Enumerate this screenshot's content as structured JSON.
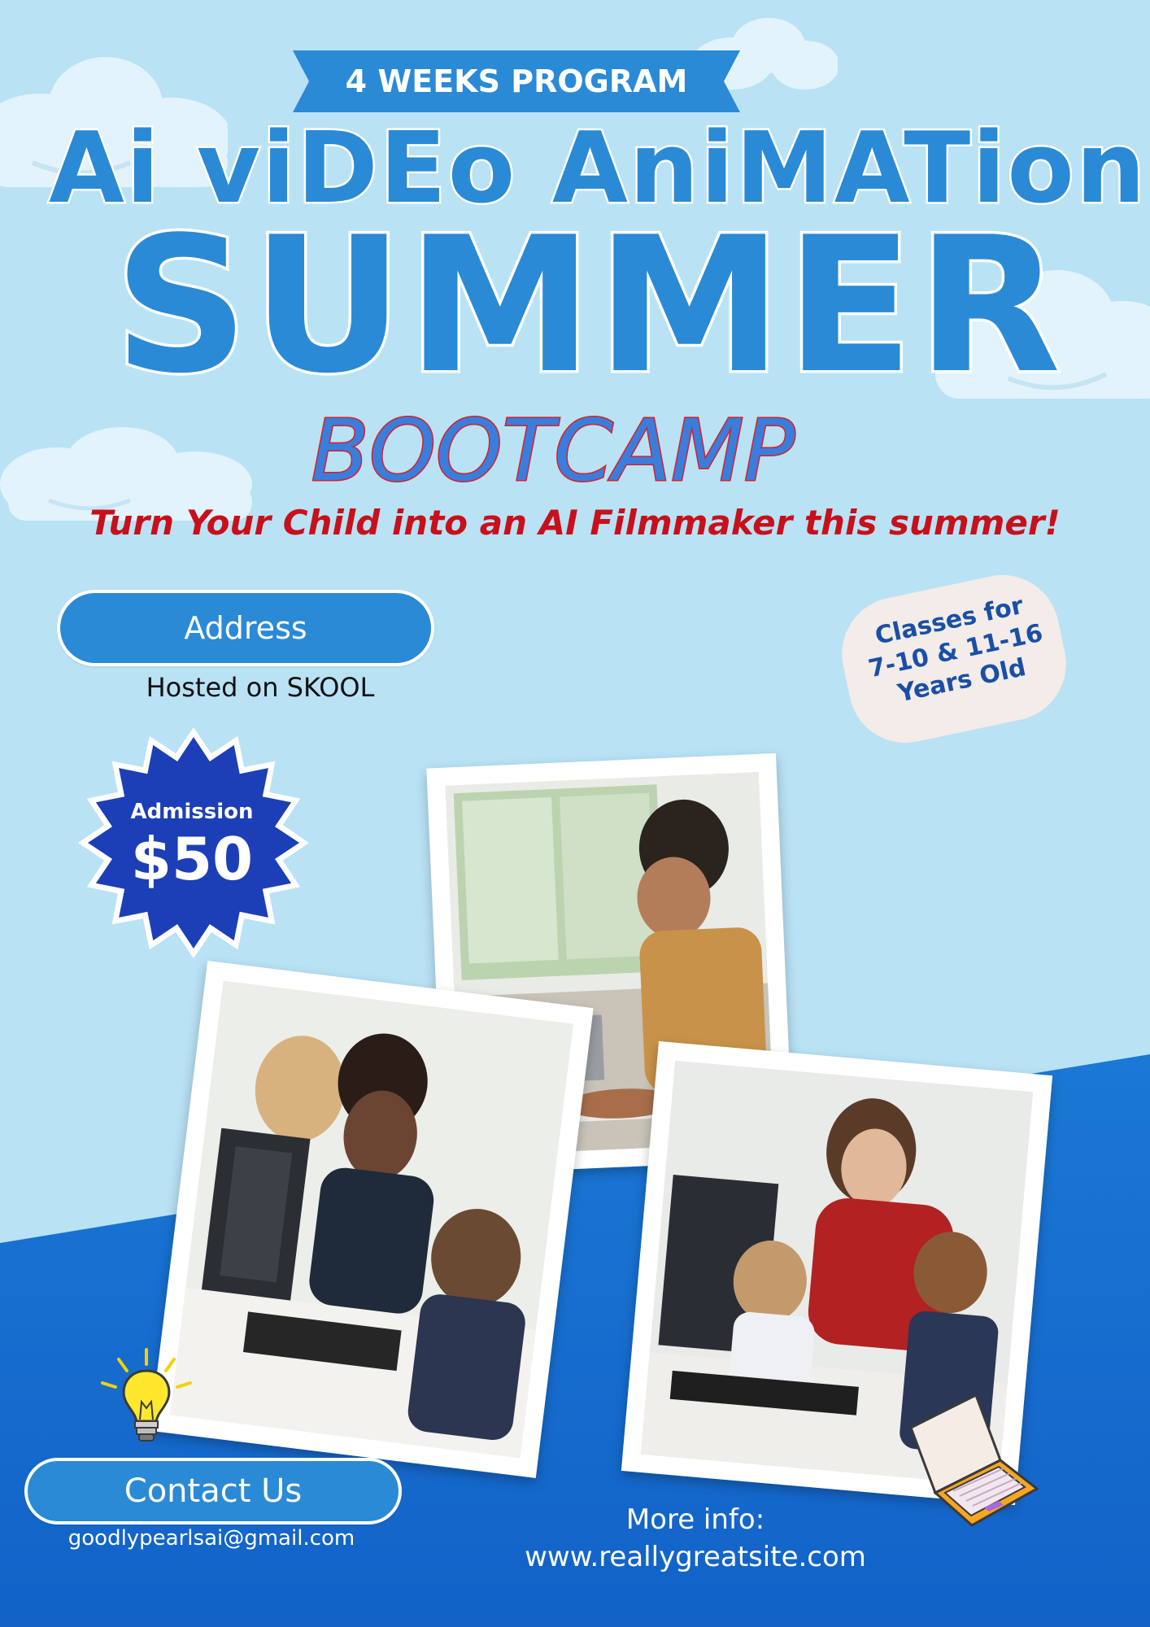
{
  "poster": {
    "ribbon_text": "4 WEEKS PROGRAM",
    "title_line1": "Ai viDEo AniMATion",
    "title_line2": "SUMMER",
    "title_line3": "BOOTCAMP",
    "tagline": "Turn Your Child into an AI Filmmaker this summer!"
  },
  "address": {
    "label": "Address",
    "value": "Hosted on SKOOL"
  },
  "classes_badge": {
    "line1": "Classes for",
    "line2": "7-10 & 11-16",
    "line3": "Years Old"
  },
  "admission": {
    "label": "Admission",
    "price": "$50"
  },
  "contact": {
    "label": "Contact Us",
    "email": "goodlypearlsai@gmail.com"
  },
  "more_info": {
    "label": "More info:",
    "url": "www.reallygreatsite.com"
  },
  "colors": {
    "sky": "#b9e2f5",
    "accent_blue": "#2a8ad6",
    "deep_blue": "#1565c8",
    "tagline_red": "#c8101b",
    "badge_navy": "#1c3fb8"
  },
  "icons": [
    "cloud-icon",
    "star-badge-icon",
    "lightbulb-icon",
    "laptop-icon"
  ]
}
